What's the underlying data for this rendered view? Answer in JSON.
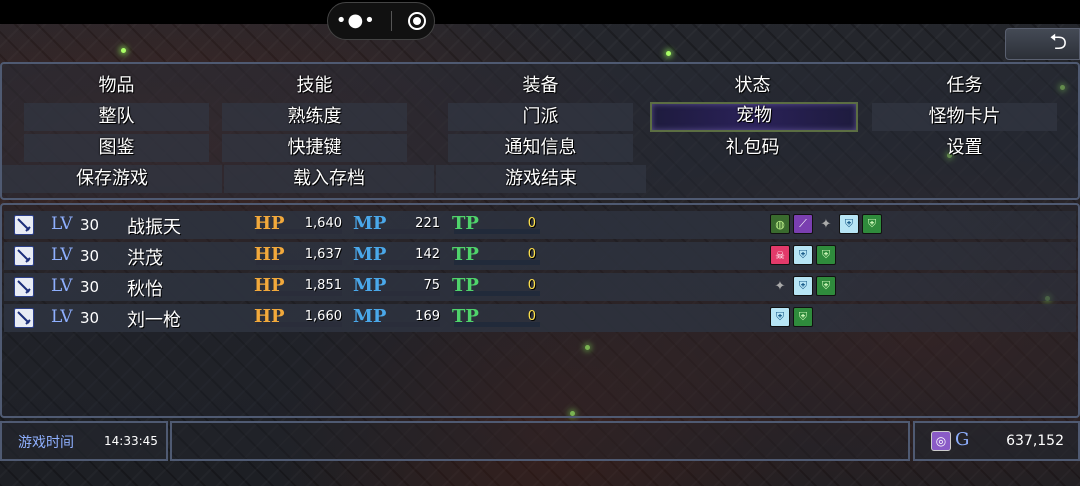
{
  "menu": {
    "items": [
      {
        "label": "物品"
      },
      {
        "label": "技能"
      },
      {
        "label": "装备"
      },
      {
        "label": "状态"
      },
      {
        "label": "任务"
      },
      {
        "label": "整队"
      },
      {
        "label": "熟练度"
      },
      {
        "label": "门派"
      },
      {
        "label": "宠物"
      },
      {
        "label": "怪物卡片"
      },
      {
        "label": "图鉴"
      },
      {
        "label": "快捷键"
      },
      {
        "label": "通知信息"
      },
      {
        "label": "礼包码"
      },
      {
        "label": "设置"
      },
      {
        "label": "保存游戏"
      },
      {
        "label": "载入存档"
      },
      {
        "label": "游戏结束"
      }
    ],
    "selected": "宠物"
  },
  "party": {
    "labels": {
      "lv": "LV",
      "hp": "HP",
      "mp": "MP",
      "tp": "TP"
    },
    "members": [
      {
        "name": "战振天",
        "level": "30",
        "hp": "1,640",
        "mp": "221",
        "tp": "0",
        "hp_fraction": 0.95,
        "mp_fraction": 0.85,
        "tp_fraction": 0,
        "states": [
          "circle-green-icon",
          "purple-slash-icon",
          "spike-icon",
          "shield-blue-icon",
          "shield-green-icon"
        ]
      },
      {
        "name": "洪茂",
        "level": "30",
        "hp": "1,637",
        "mp": "142",
        "tp": "0",
        "hp_fraction": 0.95,
        "mp_fraction": 0.9,
        "tp_fraction": 0,
        "states": [
          "skull-icon",
          "shield-blue-icon",
          "shield-green-icon"
        ]
      },
      {
        "name": "秋怡",
        "level": "30",
        "hp": "1,851",
        "mp": "75",
        "tp": "0",
        "hp_fraction": 0.95,
        "mp_fraction": 0.85,
        "tp_fraction": 0,
        "states": [
          "spike-icon",
          "shield-blue-icon",
          "shield-green-icon"
        ]
      },
      {
        "name": "刘一枪",
        "level": "30",
        "hp": "1,660",
        "mp": "169",
        "tp": "0",
        "hp_fraction": 0.95,
        "mp_fraction": 0.88,
        "tp_fraction": 0,
        "states": [
          "shield-blue-icon",
          "shield-green-icon"
        ]
      }
    ]
  },
  "footer": {
    "play_time_label": "游戏时间",
    "play_time": "14:33:45",
    "gold_label": "G",
    "gold": "637,152"
  },
  "colors": {
    "hp": "#f2a93b",
    "mp": "#4aa8ea",
    "tp": "#4fd36b",
    "panel_border": "#4f5a72"
  },
  "system": {
    "capsule_menu_icon": "more-dots-icon",
    "capsule_close_icon": "target-circle-icon",
    "back_icon": "back-arrow-icon"
  }
}
